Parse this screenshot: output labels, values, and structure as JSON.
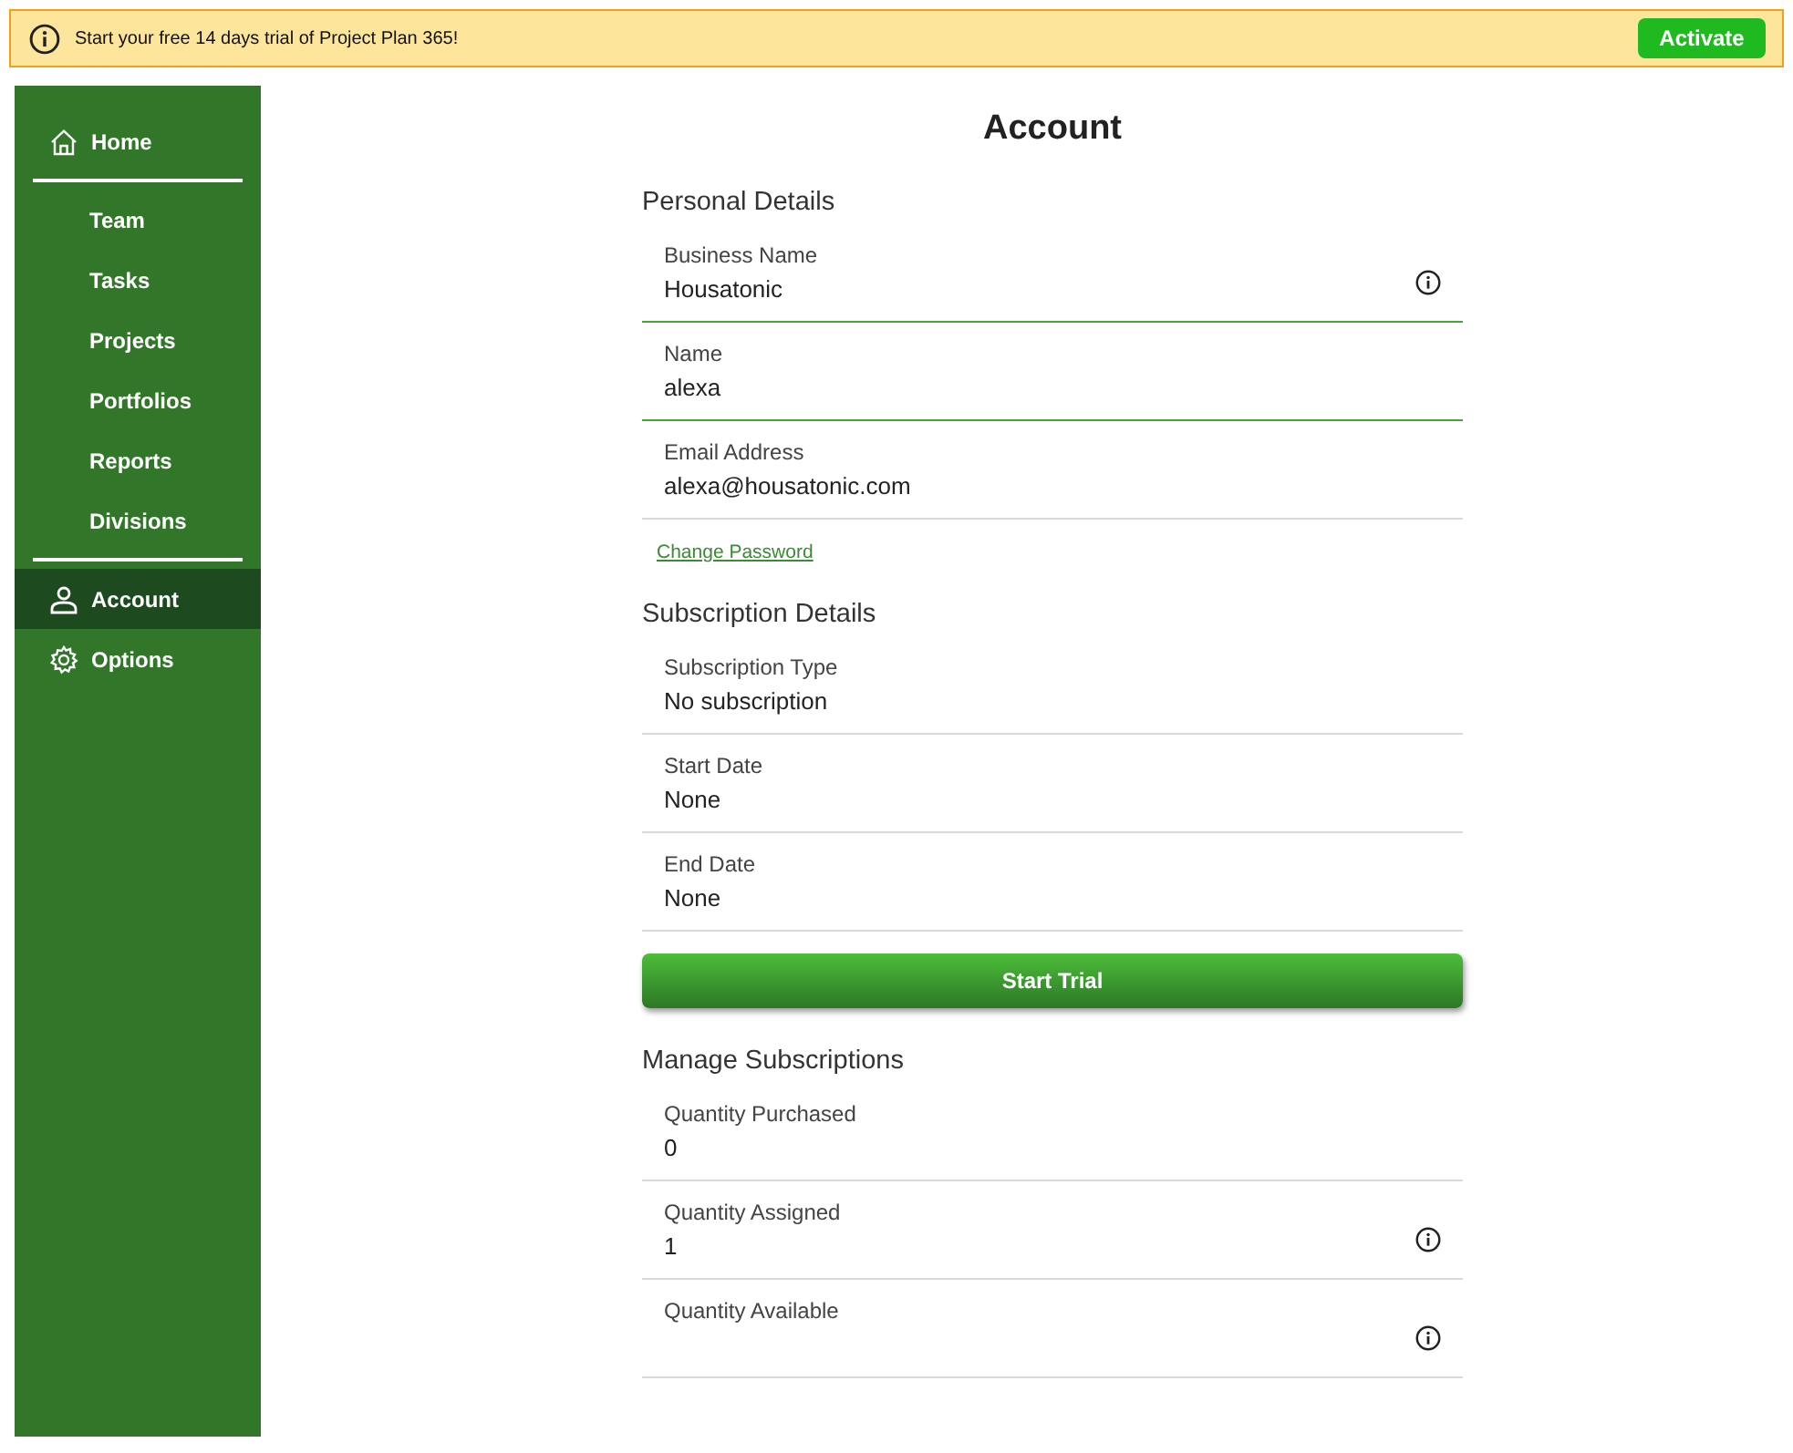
{
  "banner": {
    "message": "Start your free 14 days trial of Project Plan 365!",
    "button": "Activate"
  },
  "sidebar": {
    "groups": [
      {
        "items": [
          {
            "label": "Home",
            "kind": "main",
            "selected": false
          }
        ]
      },
      {
        "items": [
          {
            "label": "Team",
            "kind": "sub",
            "selected": false
          },
          {
            "label": "Tasks",
            "kind": "sub",
            "selected": false
          },
          {
            "label": "Projects",
            "kind": "sub",
            "selected": false
          },
          {
            "label": "Portfolios",
            "kind": "sub",
            "selected": false
          },
          {
            "label": "Reports",
            "kind": "sub",
            "selected": false
          },
          {
            "label": "Divisions",
            "kind": "sub",
            "selected": false
          }
        ]
      },
      {
        "items": [
          {
            "label": "Account",
            "kind": "main",
            "selected": true
          },
          {
            "label": "Options",
            "kind": "main",
            "selected": false
          }
        ]
      }
    ]
  },
  "page": {
    "title": "Account",
    "sections": [
      {
        "heading": "Personal Details",
        "fields": [
          {
            "label": "Business Name",
            "value": "Housatonic",
            "focused": true,
            "info": true
          },
          {
            "label": "Name",
            "value": "alexa",
            "focused": true,
            "info": false
          },
          {
            "label": "Email Address",
            "value": "alexa@housatonic.com",
            "focused": false,
            "info": false
          }
        ],
        "link": "Change Password"
      },
      {
        "heading": "Subscription Details",
        "fields": [
          {
            "label": "Subscription Type",
            "value": "No subscription",
            "focused": false,
            "info": false
          },
          {
            "label": "Start Date",
            "value": "None",
            "focused": false,
            "info": false
          },
          {
            "label": "End Date",
            "value": "None",
            "focused": false,
            "info": false
          }
        ],
        "button": "Start Trial"
      },
      {
        "heading": "Manage Subscriptions",
        "fields": [
          {
            "label": "Quantity Purchased",
            "value": "0",
            "focused": false,
            "info": false
          },
          {
            "label": "Quantity Assigned",
            "value": "1",
            "focused": false,
            "info": true
          },
          {
            "label": "Quantity Available",
            "focused": false,
            "info": true
          }
        ]
      }
    ]
  }
}
